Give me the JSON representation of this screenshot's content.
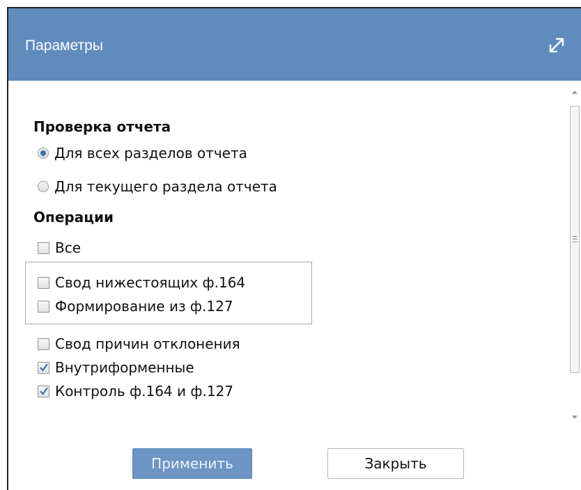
{
  "dialog": {
    "title": "Параметры",
    "maximize_icon": "expand-arrows-icon"
  },
  "report_check": {
    "title": "Проверка отчета",
    "options": [
      {
        "label": "Для всех разделов отчета",
        "selected": true
      },
      {
        "label": "Для текущего раздела отчета",
        "selected": false
      }
    ]
  },
  "operations": {
    "title": "Операции",
    "all": {
      "label": "Все",
      "checked": false
    },
    "group": [
      {
        "label": "Свод нижестоящих ф.164",
        "checked": false
      },
      {
        "label": "Формирование из ф.127",
        "checked": false
      }
    ],
    "items": [
      {
        "label": "Свод причин отклонения",
        "checked": false
      },
      {
        "label": "Внутриформенные",
        "checked": true
      },
      {
        "label": "Контроль ф.164 и ф.127",
        "checked": true
      }
    ]
  },
  "buttons": {
    "apply_label": "Применить",
    "close_label": "Закрыть"
  },
  "colors": {
    "titlebar": "#5f8bbd",
    "apply_button": "#6c95c3",
    "check_accent": "#3a6fb0"
  }
}
